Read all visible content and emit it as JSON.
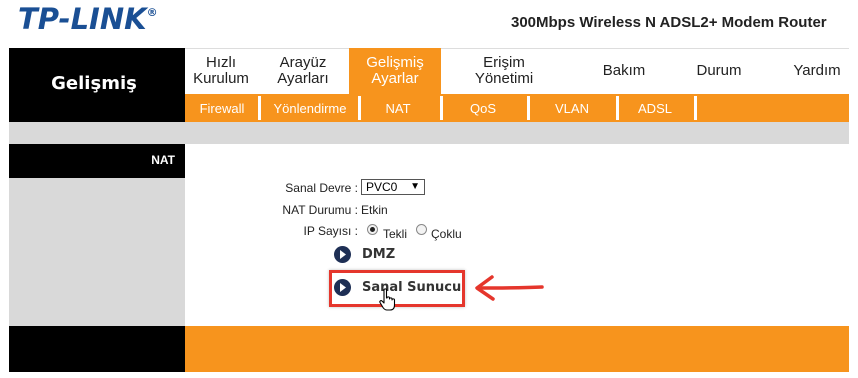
{
  "header": {
    "logo": "TP-LINK",
    "logo_mark": "®",
    "model": "300Mbps Wireless N ADSL2+ Modem Router"
  },
  "section_title": "Gelişmiş",
  "main_nav": [
    {
      "line1": "Hızlı",
      "line2": "Kurulum",
      "active": false
    },
    {
      "line1": "Arayüz",
      "line2": "Ayarları",
      "active": false
    },
    {
      "line1": "Gelişmiş",
      "line2": "Ayarlar",
      "active": true
    },
    {
      "line1": "Erişim",
      "line2": "Yönetimi",
      "active": false
    },
    {
      "line1": "Bakım",
      "line2": "",
      "active": false
    },
    {
      "line1": "Durum",
      "line2": "",
      "active": false
    },
    {
      "line1": "Yardım",
      "line2": "",
      "active": false
    }
  ],
  "sub_nav": [
    "Firewall",
    "Yönlendirme",
    "NAT",
    "QoS",
    "VLAN",
    "ADSL"
  ],
  "left_label": "NAT",
  "form": {
    "sanal_devre_label": "Sanal Devre :",
    "sanal_devre_value": "PVC0",
    "nat_durumu_label": "NAT Durumu :",
    "nat_durumu_value": "Etkin",
    "ip_sayisi_label": "IP Sayısı :",
    "ip_option_1": "Tekli",
    "ip_option_2": "Çoklu",
    "ip_selected": "Tekli"
  },
  "links": {
    "dmz": "DMZ",
    "sanal_sunucu": "Sanal Sunucu"
  },
  "colors": {
    "orange": "#f7941d",
    "logo_blue": "#1a4f94",
    "annotation_red": "#e5362c"
  }
}
